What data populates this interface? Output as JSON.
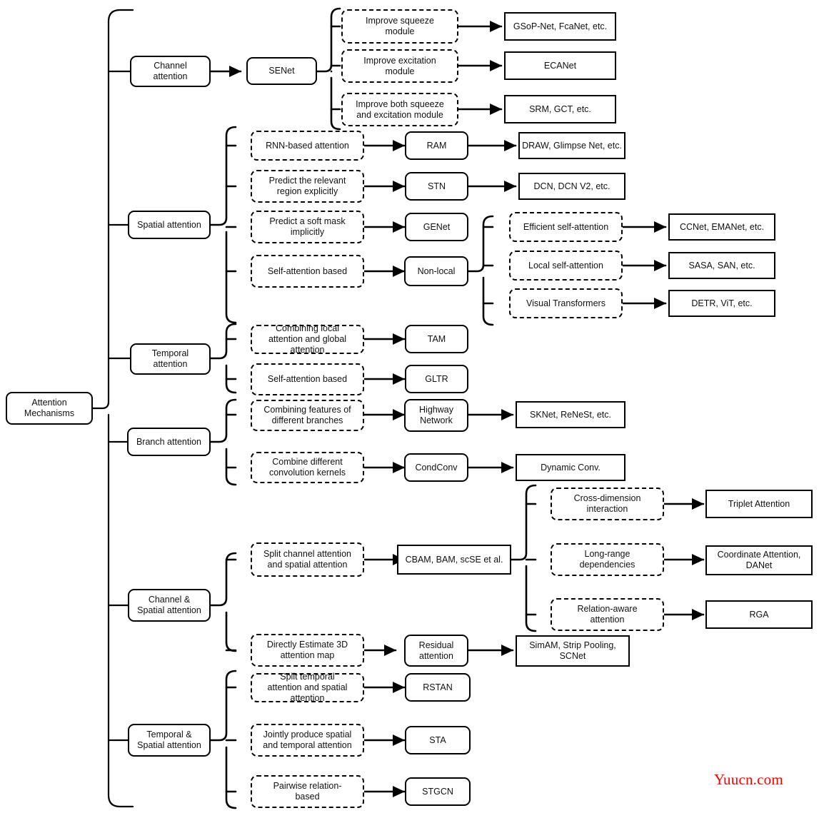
{
  "diagram": {
    "title": "Attention Mechanisms taxonomy",
    "root": {
      "id": "root",
      "label": "Attention\nMechanisms"
    },
    "watermark": "Yuucn.com",
    "colors": {
      "stroke": "#000000",
      "text": "#111111",
      "background": "#ffffff",
      "watermark": "#ff0000"
    },
    "categories": [
      {
        "id": "channel-attention",
        "label": "Channel\nattention"
      },
      {
        "id": "spatial-attention",
        "label": "Spatial attention"
      },
      {
        "id": "temporal-attention",
        "label": "Temporal\nattention"
      },
      {
        "id": "branch-attention",
        "label": "Branch attention"
      },
      {
        "id": "channel-spatial-attention",
        "label": "Channel &\nSpatial attention"
      },
      {
        "id": "temporal-spatial-attention",
        "label": "Temporal &\nSpatial attention"
      }
    ],
    "nodes": {
      "senet": "SENet",
      "improve_squeeze": "Improve squeeze\nmodule",
      "improve_excitation": "Improve excitation\nmodule",
      "improve_both": "Improve both squeeze\nand excitation module",
      "gsop": "GSoP-Net, FcaNet, etc.",
      "ecanet": "ECANet",
      "srm": "SRM, GCT, etc.",
      "rnn_based": "RNN-based attention",
      "ram": "RAM",
      "draw": "DRAW, Glimpse Net, etc.",
      "predict_relevant": "Predict the relevant\nregion explicitly",
      "stn": "STN",
      "dcn": "DCN, DCN V2,  etc.",
      "predict_soft": "Predict a soft mask\nimplicitly",
      "genet": "GENet",
      "self_attention_based_spatial": "Self-attention based",
      "nonlocal": "Non-local",
      "efficient_self_attention": "Efficient self-attention",
      "ccnet": "CCNet, EMANet, etc.",
      "local_self_attention": "Local self-attention",
      "sasa": "SASA, SAN, etc.",
      "visual_transformers": "Visual Transformers",
      "detr": "DETR, ViT, etc.",
      "combining_local_global": "Combining local\nattention and global\nattention",
      "tam": "TAM",
      "self_attention_based_temporal": "Self-attention based",
      "gltr": "GLTR",
      "combining_features": "Combining features of\ndifferent branches",
      "highway": "Highway\nNetwork",
      "sknet": "SKNet, ReNeSt,  etc.",
      "combine_kernels": "Combine different\nconvolution kernels",
      "condconv": "CondConv",
      "dynamic_conv": "Dynamic Conv.",
      "split_channel_spatial": "Split channel attention\nand spatial attention",
      "cbam": "CBAM, BAM, scSE et al.",
      "cross_dimension": "Cross-dimension\ninteraction",
      "triplet": "Triplet Attention",
      "long_range": "Long-range\ndependencies",
      "coordinate": "Coordinate Attention,\nDANet",
      "relation_aware": "Relation-aware\nattention",
      "rga": "RGA",
      "directly_estimate": "Directly Estimate 3D\nattention map",
      "residual_attention": "Residual\nattention",
      "simam": "SimAM, Strip Pooling,\nSCNet",
      "split_temporal_spatial": "Split temporal\nattention and spatial\nattention",
      "rstan": "RSTAN",
      "jointly_produce": "Jointly produce spatial\nand temporal attention",
      "sta": "STA",
      "pairwise_relation": "Pairwise relation-\nbased",
      "stgcn": "STGCN"
    }
  }
}
